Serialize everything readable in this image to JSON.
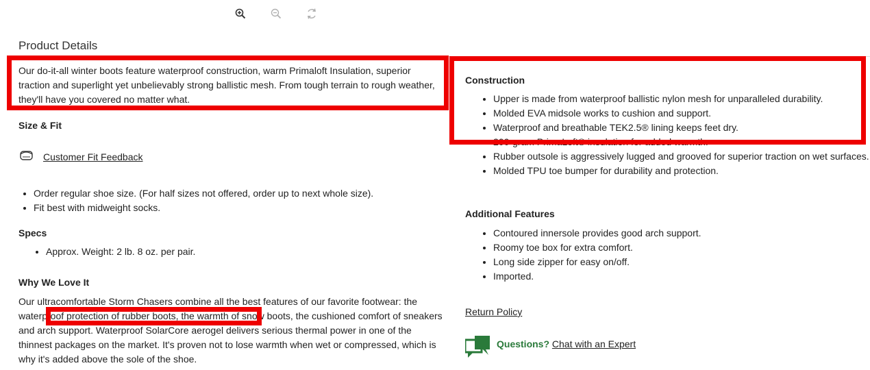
{
  "toolbar": {
    "zoom_in_icon": "zoom-in-icon",
    "zoom_out_icon": "zoom-out-icon",
    "rotate_icon": "rotate-icon"
  },
  "product_details": {
    "title": "Product Details",
    "intro": "Our do-it-all winter boots feature waterproof construction, warm Primaloft Insulation, superior traction and superlight yet unbelievably strong ballistic mesh. From tough terrain to rough weather, they'll have you covered no matter what.",
    "size_fit": {
      "heading": "Size & Fit",
      "feedback_link": "Customer Fit Feedback",
      "items": [
        "Order regular shoe size. (For half sizes not offered, order up to next whole size).",
        "Fit best with midweight socks."
      ]
    },
    "specs": {
      "heading": "Specs",
      "items": [
        "Approx. Weight: 2 lb. 8 oz. per pair."
      ]
    },
    "why": {
      "heading": "Why We Love It",
      "text": "Our ultracomfortable Storm Chasers combine all the best features of our favorite footwear: the waterproof protection of rubber boots, the warmth of snow boots, the cushioned comfort of sneakers and arch support. Waterproof SolarCore aerogel delivers serious thermal power in one of the thinnest packages on the market. It's proven not to lose warmth when wet or compressed, which is why it's added above the sole of the shoe."
    },
    "construction": {
      "heading": "Construction",
      "items": [
        "Upper is made from waterproof ballistic nylon mesh for unparalleled durability.",
        "Molded EVA midsole works to cushion and support.",
        "Waterproof and breathable TEK2.5® lining keeps feet dry.",
        "200-gram PrimaLoft® insulation for added warmth.",
        "Rubber outsole is aggressively lugged and grooved for superior traction on wet surfaces.",
        "Molded TPU toe bumper for durability and protection."
      ]
    },
    "additional": {
      "heading": "Additional Features",
      "items": [
        "Contoured innersole provides good arch support.",
        "Roomy toe box for extra comfort.",
        "Long side zipper for easy on/off.",
        "Imported."
      ]
    },
    "return_policy": "Return Policy",
    "questions": {
      "label": "Questions?",
      "link": "Chat with an Expert"
    }
  },
  "colors": {
    "highlight": "#ee0000",
    "accent_green": "#2a7a3a"
  }
}
